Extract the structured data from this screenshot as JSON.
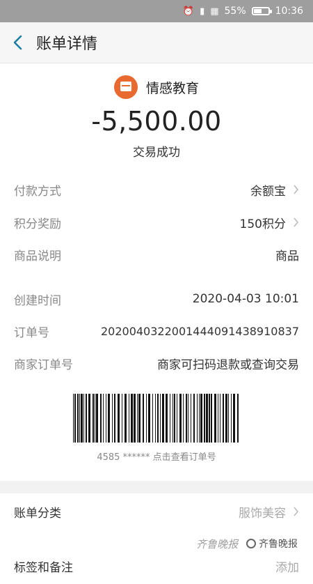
{
  "status_bar": {
    "battery": "55%",
    "battery_level": 0.55,
    "time": "10:36",
    "icons": [
      "alarm-icon",
      "signal-icon",
      "network-icon"
    ]
  },
  "app_bar": {
    "title": "账单详情",
    "back_icon": "chevron-left-icon",
    "accent": "#1a7fa3"
  },
  "summary": {
    "merchant": "情感教育",
    "amount": "-5,500.00",
    "status": "交易成功",
    "logo_color": "#e86a2f"
  },
  "details": [
    {
      "label": "付款方式",
      "value": "余额宝",
      "chevron": true
    },
    {
      "label": "积分奖励",
      "value": "150积分",
      "chevron": true
    },
    {
      "label": "商品说明",
      "value": "商品",
      "chevron": false
    }
  ],
  "order": [
    {
      "label": "创建时间",
      "value": "2020-04-03 10:01"
    },
    {
      "label": "订单号",
      "value": "2020040322001444091438910837"
    },
    {
      "label": "商家订单号",
      "value": "商家可扫码退款或查询交易"
    }
  ],
  "barcode": {
    "caption": "4585 ****** 点击查看订单号"
  },
  "bottom": [
    {
      "label": "账单分类",
      "value": "服饰美容"
    },
    {
      "label": "标签和备注",
      "value": "添加"
    }
  ],
  "watermark": {
    "text": "齐鲁晚报",
    "logo_text": "齐鲁晚报"
  }
}
